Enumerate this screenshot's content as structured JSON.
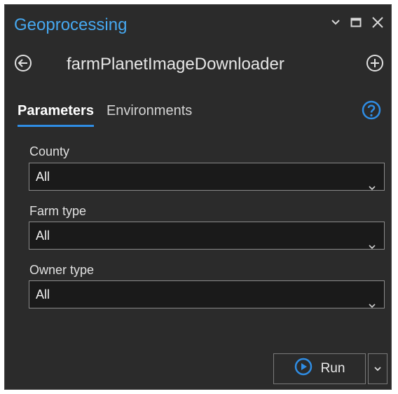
{
  "pane": {
    "title": "Geoprocessing"
  },
  "tool": {
    "name": "farmPlanetImageDownloader"
  },
  "tabs": [
    {
      "label": "Parameters",
      "active": true
    },
    {
      "label": "Environments",
      "active": false
    }
  ],
  "parameters": [
    {
      "label": "County",
      "value": "All"
    },
    {
      "label": "Farm type",
      "value": "All"
    },
    {
      "label": "Owner type",
      "value": "All"
    }
  ],
  "run": {
    "label": "Run"
  },
  "icons": {
    "pane_options": "chevron-down-icon",
    "maximize": "maximize-icon",
    "close": "close-icon",
    "back": "back-arrow-icon",
    "add": "plus-circle-icon",
    "help": "help-icon",
    "run": "play-icon",
    "run_menu": "chevron-down-icon"
  },
  "colors": {
    "accent": "#46a8f0",
    "background": "#2b2b2b",
    "field_background": "#1a1a1a"
  }
}
